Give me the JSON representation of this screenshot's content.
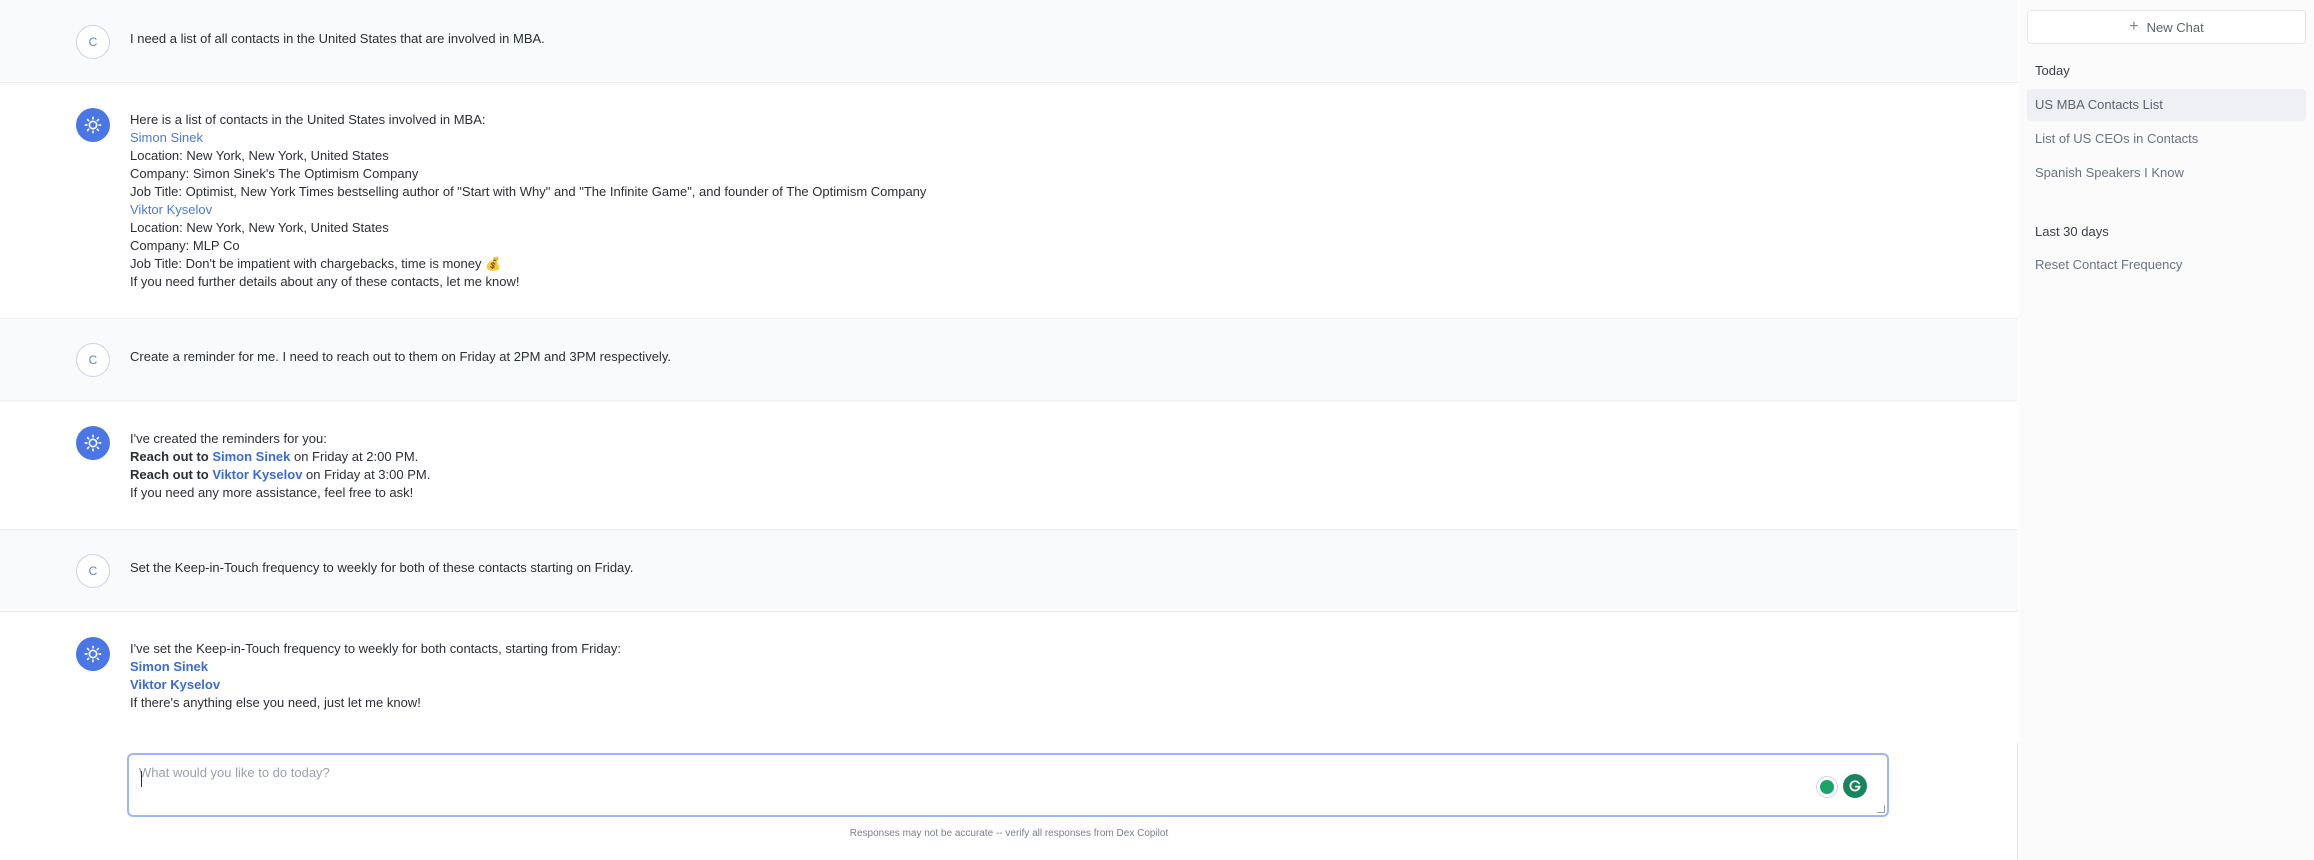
{
  "conversation": {
    "messages": [
      {
        "role": "user",
        "avatar_letter": "C",
        "lines": [
          [
            {
              "text": "I need a list of all contacts in the United States that are involved in MBA."
            }
          ]
        ]
      },
      {
        "role": "assistant",
        "lines": [
          [
            {
              "text": "Here is a list of contacts in the United States involved in MBA:"
            }
          ],
          [
            {
              "text": "Simon Sinek",
              "style": "link"
            }
          ],
          [
            {
              "text": "Location: New York, New York, United States"
            }
          ],
          [
            {
              "text": "Company: Simon Sinek's The Optimism Company"
            }
          ],
          [
            {
              "text": "Job Title: Optimist, New York Times bestselling author of \"Start with Why\" and \"The Infinite Game\", and founder of The Optimism Company"
            }
          ],
          [
            {
              "text": "Viktor Kyselov",
              "style": "link"
            }
          ],
          [
            {
              "text": "Location: New York, New York, United States"
            }
          ],
          [
            {
              "text": "Company: MLP Co"
            }
          ],
          [
            {
              "text": "Job Title: Don't be impatient with chargebacks, time is money 💰"
            }
          ],
          [
            {
              "text": "If you need further details about any of these contacts, let me know!"
            }
          ]
        ]
      },
      {
        "role": "user",
        "avatar_letter": "C",
        "lines": [
          [
            {
              "text": "Create a reminder for me. I need to reach out to them on Friday at 2PM and 3PM respectively."
            }
          ]
        ]
      },
      {
        "role": "assistant",
        "lines": [
          [
            {
              "text": "I've created the reminders for you:"
            }
          ],
          [
            {
              "text": "Reach out to ",
              "style": "strong"
            },
            {
              "text": "Simon Sinek",
              "style": "link-strong"
            },
            {
              "text": " on Friday at 2:00 PM."
            }
          ],
          [
            {
              "text": "Reach out to ",
              "style": "strong"
            },
            {
              "text": "Viktor Kyselov",
              "style": "link-strong"
            },
            {
              "text": " on Friday at 3:00 PM."
            }
          ],
          [
            {
              "text": "If you need any more assistance, feel free to ask!"
            }
          ]
        ]
      },
      {
        "role": "user",
        "avatar_letter": "C",
        "lines": [
          [
            {
              "text": "Set the Keep-in-Touch frequency to weekly for both of these contacts starting on Friday."
            }
          ]
        ]
      },
      {
        "role": "assistant",
        "lines": [
          [
            {
              "text": "I've set the Keep-in-Touch frequency to weekly for both contacts, starting from Friday:"
            }
          ],
          [
            {
              "text": "Simon Sinek",
              "style": "link-strong"
            }
          ],
          [
            {
              "text": "Viktor Kyselov",
              "style": "link-strong"
            }
          ],
          [
            {
              "text": "If there's anything else you need, just let me know!"
            }
          ]
        ]
      }
    ]
  },
  "composer": {
    "placeholder": "What would you like to do today?",
    "value": ""
  },
  "disclaimer": "Responses may not be accurate -- verify all responses from Dex Copilot",
  "sidebar": {
    "new_chat_label": "New Chat",
    "sections": [
      {
        "heading": "Today",
        "items": [
          {
            "label": "US MBA Contacts List",
            "active": true
          },
          {
            "label": "List of US CEOs in Contacts",
            "active": false
          },
          {
            "label": "Spanish Speakers I Know",
            "active": false
          }
        ]
      },
      {
        "heading": "Last 30 days",
        "items": [
          {
            "label": "Reset Contact Frequency",
            "active": false
          }
        ]
      }
    ]
  },
  "colors": {
    "accent": "#4a77e5",
    "link": "#4b79de",
    "user_row_bg": "#f9fafb",
    "input_border": "#9fb6f0"
  }
}
